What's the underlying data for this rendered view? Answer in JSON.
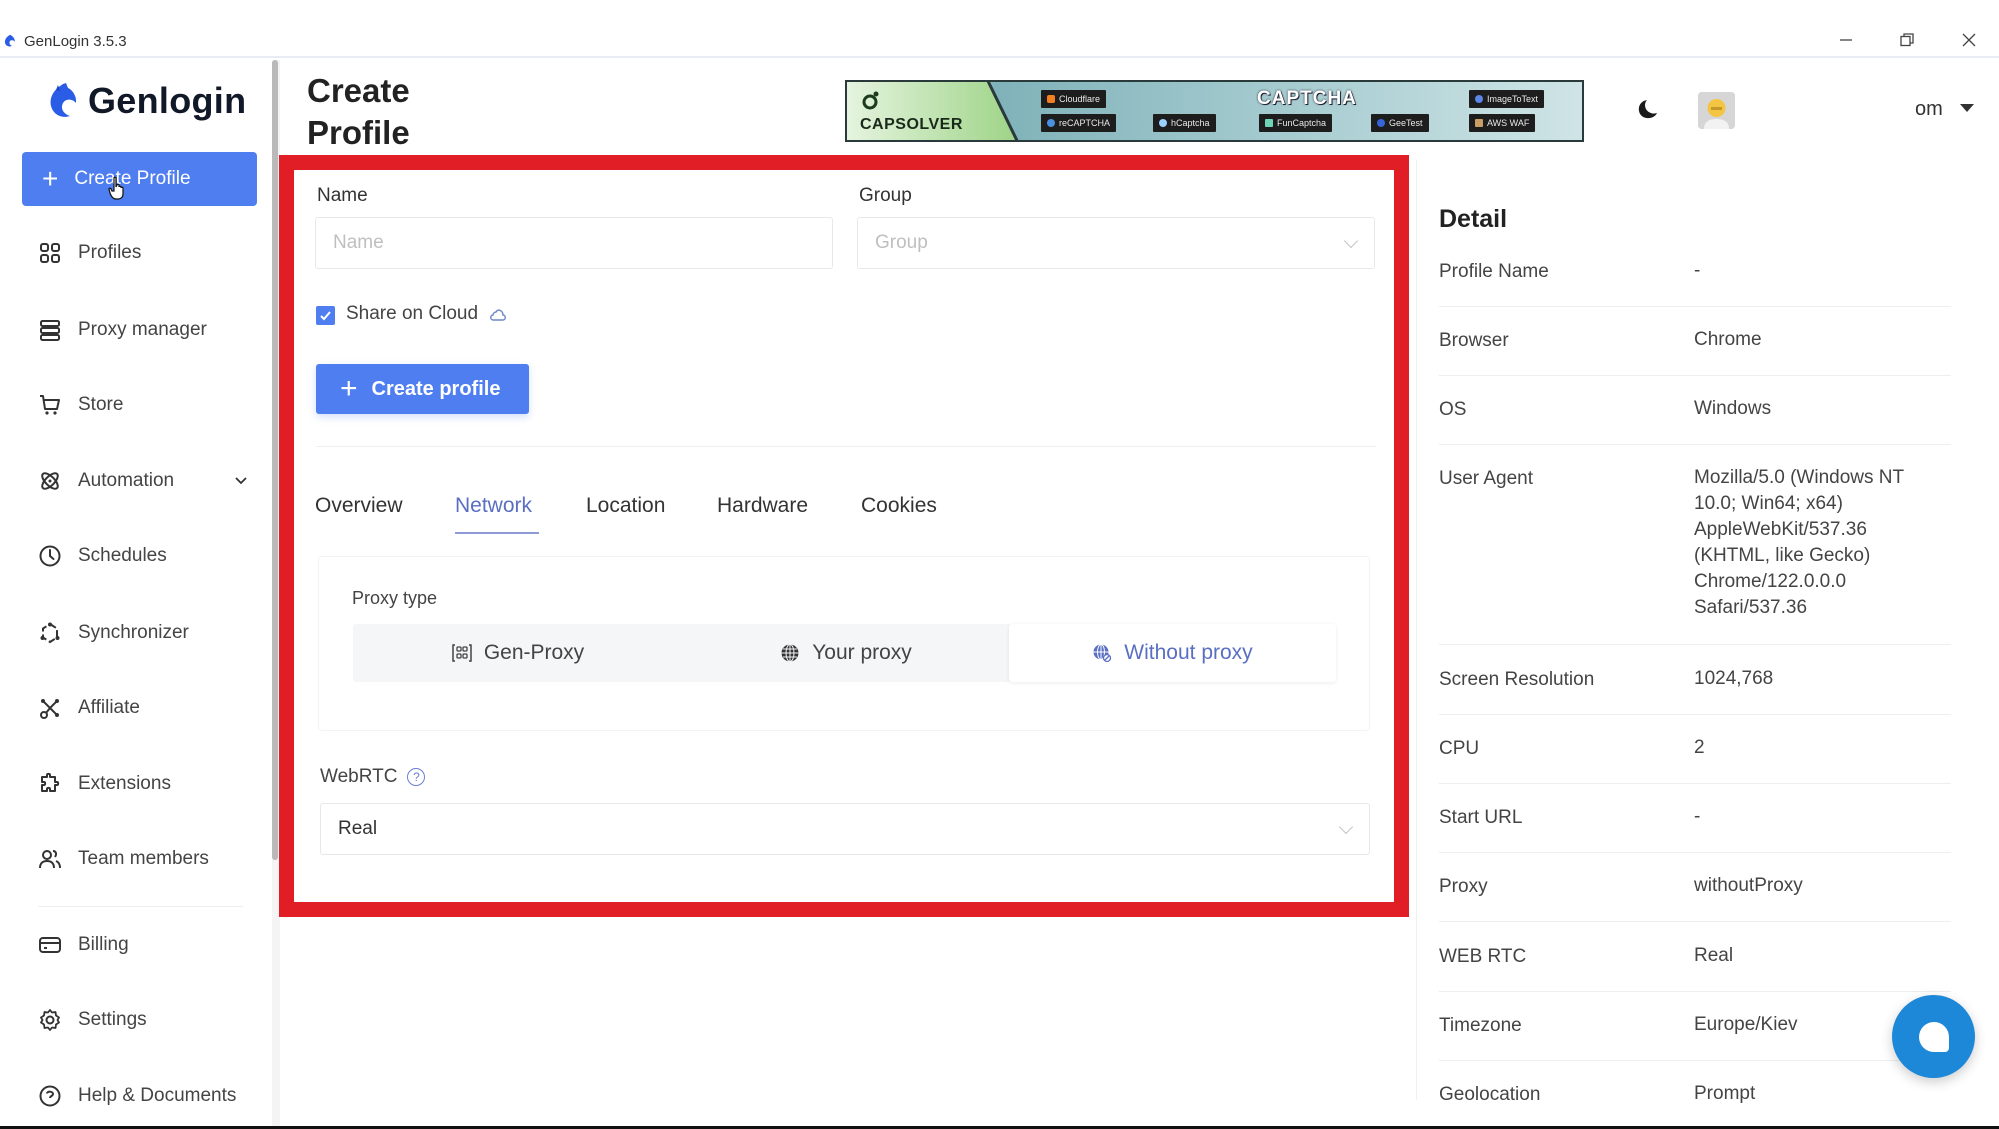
{
  "window": {
    "title": "GenLogin 3.5.3",
    "minimize_icon": "minimize-icon",
    "restore_icon": "restore-icon",
    "close_icon": "close-icon"
  },
  "sidebar": {
    "logo_text": "Genlogin",
    "create_button": "Create Profile",
    "items": [
      {
        "label": "Profiles",
        "icon": "grid-icon"
      },
      {
        "label": "Proxy manager",
        "icon": "server-icon"
      },
      {
        "label": "Store",
        "icon": "cart-icon"
      },
      {
        "label": "Automation",
        "icon": "atom-icon",
        "expandable": true
      },
      {
        "label": "Schedules",
        "icon": "clock-icon"
      },
      {
        "label": "Synchronizer",
        "icon": "sync-icon"
      },
      {
        "label": "Affiliate",
        "icon": "affiliate-icon"
      },
      {
        "label": "Extensions",
        "icon": "puzzle-icon"
      },
      {
        "label": "Team members",
        "icon": "users-icon"
      },
      {
        "label": "Billing",
        "icon": "card-icon"
      },
      {
        "label": "Settings",
        "icon": "gear-icon"
      },
      {
        "label": "Help & Documents",
        "icon": "help-icon"
      }
    ]
  },
  "header": {
    "page_title_line1": "Create",
    "page_title_line2": "Profile",
    "banner": {
      "brand": "CAPSOLVER",
      "title": "CAPTCHA",
      "chips": [
        "Cloudflare",
        "reCAPTCHA",
        "hCaptcha",
        "FunCaptcha",
        "GeeTest",
        "ImageToText",
        "AWS WAF"
      ]
    },
    "theme_icon": "moon-icon",
    "user_name_visible": "om"
  },
  "form": {
    "name_label": "Name",
    "name_placeholder": "Name",
    "name_value": "",
    "group_label": "Group",
    "group_placeholder": "Group",
    "share_on_cloud_label": "Share on Cloud",
    "share_on_cloud_checked": true,
    "create_button": "Create profile",
    "tabs": [
      {
        "label": "Overview",
        "active": false
      },
      {
        "label": "Network",
        "active": true
      },
      {
        "label": "Location",
        "active": false
      },
      {
        "label": "Hardware",
        "active": false
      },
      {
        "label": "Cookies",
        "active": false
      }
    ],
    "proxy_type_label": "Proxy type",
    "proxy_options": [
      {
        "label": "Gen-Proxy",
        "active": false
      },
      {
        "label": "Your proxy",
        "active": false
      },
      {
        "label": "Without proxy",
        "active": true
      }
    ],
    "webrtc_label": "WebRTC",
    "webrtc_value": "Real"
  },
  "detail": {
    "title": "Detail",
    "rows": [
      {
        "key": "Profile Name",
        "value": "-"
      },
      {
        "key": "Browser",
        "value": "Chrome"
      },
      {
        "key": "OS",
        "value": "Windows"
      },
      {
        "key": "User Agent",
        "value": "Mozilla/5.0 (Windows NT 10.0; Win64; x64) AppleWebKit/537.36 (KHTML, like Gecko) Chrome/122.0.0.0 Safari/537.36"
      },
      {
        "key": "Screen Resolution",
        "value": "1024,768"
      },
      {
        "key": "CPU",
        "value": "2"
      },
      {
        "key": "Start URL",
        "value": "-"
      },
      {
        "key": "Proxy",
        "value": "withoutProxy"
      },
      {
        "key": "WEB RTC",
        "value": "Real"
      },
      {
        "key": "Timezone",
        "value": "Europe/Kiev"
      },
      {
        "key": "Geolocation",
        "value": "Prompt"
      }
    ]
  },
  "colors": {
    "primary": "#4f7ef0",
    "active_tab": "#5a6fc2",
    "highlight_border": "#e11d25",
    "chat_fab": "#1d87d8"
  }
}
